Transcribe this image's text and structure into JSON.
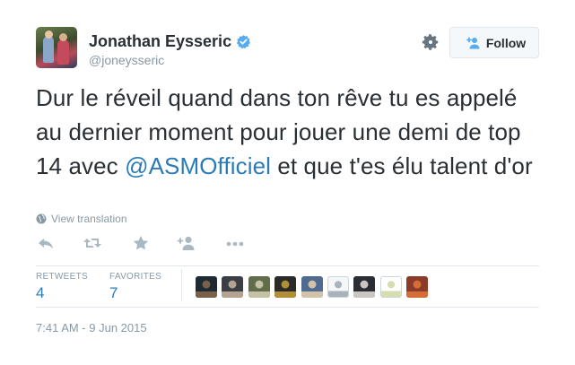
{
  "author": {
    "display_name": "Jonathan Eysseric",
    "handle": "@joneysseric",
    "verified": true
  },
  "follow_button": {
    "label": "Follow",
    "icon": "user-plus-icon"
  },
  "settings_icon": "gear-icon",
  "tweet": {
    "text_before": "Dur le réveil quand dans ton rêve tu es appelé au dernier moment pour jouer une demi de top 14 avec ",
    "mention": "@ASMOfficiel",
    "text_after": " et que t'es élu talent d'or"
  },
  "view_translation": {
    "label": "View translation",
    "icon": "globe-icon"
  },
  "actions": [
    {
      "name": "reply",
      "icon": "reply-icon"
    },
    {
      "name": "retweet",
      "icon": "retweet-icon"
    },
    {
      "name": "favorite",
      "icon": "star-icon"
    },
    {
      "name": "follow",
      "icon": "user-plus-icon"
    },
    {
      "name": "more",
      "icon": "more-icon"
    }
  ],
  "stats": {
    "retweets_label": "RETWEETS",
    "retweets": "4",
    "favorites_label": "FAVORITES",
    "favorites": "7"
  },
  "favoriter_avatars": [
    {
      "color": "#1f2a33",
      "accent": "#8a6b4e"
    },
    {
      "color": "#3b3f45",
      "accent": "#c9b59e"
    },
    {
      "color": "#5f6d4a",
      "accent": "#d8d0b5"
    },
    {
      "color": "#2a2a2a",
      "accent": "#c9a23a"
    },
    {
      "color": "#4f6b8f",
      "accent": "#e9d2b0"
    },
    {
      "color": "#f4f6f8",
      "accent": "#9aa7b2"
    },
    {
      "color": "#2a2d33",
      "accent": "#e7e2dc"
    },
    {
      "color": "#ffffff",
      "accent": "#cfd8a0"
    },
    {
      "color": "#8c3b2a",
      "accent": "#e0783a"
    }
  ],
  "timestamp": "7:41 AM - 9 Jun 2015",
  "colors": {
    "link": "#2b7bb9",
    "muted": "#8899a6",
    "verified_badge": "#55acee",
    "text": "#292f33"
  }
}
